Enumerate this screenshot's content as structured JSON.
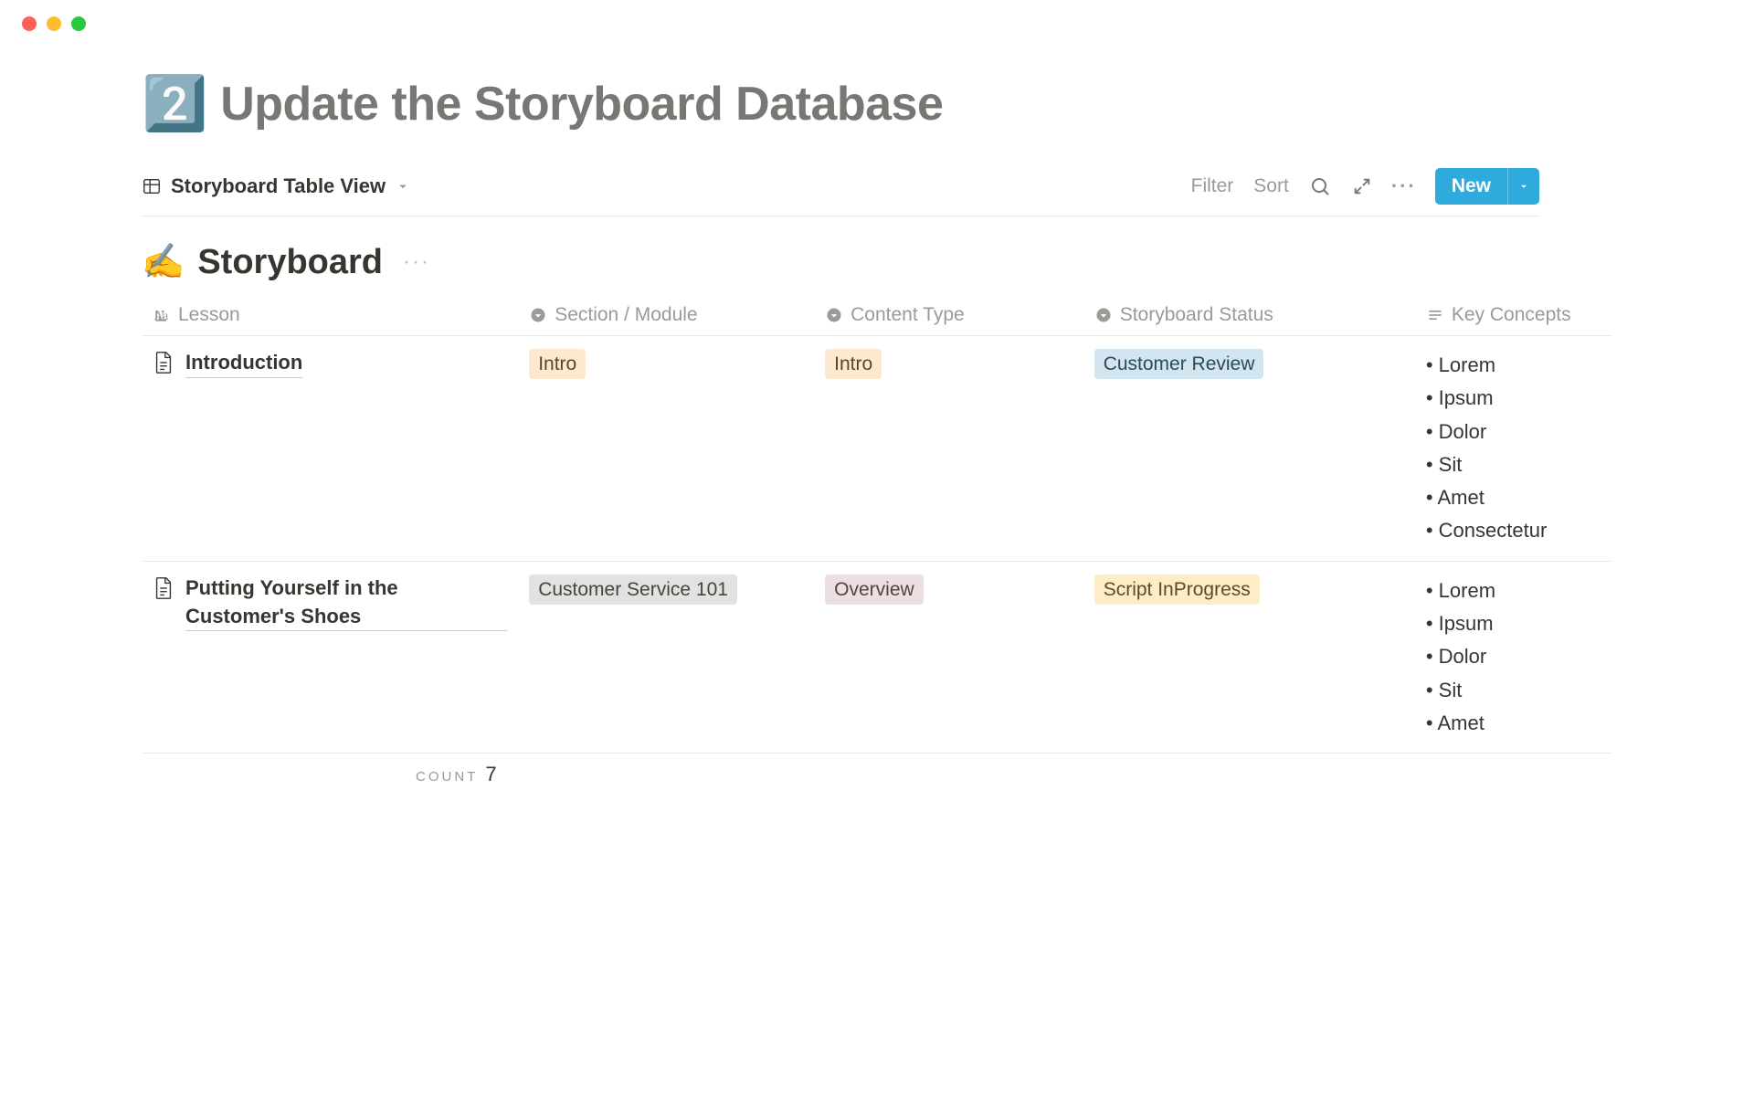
{
  "page": {
    "emoji": "2️⃣",
    "title": "Update the Storyboard Database"
  },
  "view": {
    "name": "Storyboard Table View",
    "filter_label": "Filter",
    "sort_label": "Sort",
    "new_label": "New"
  },
  "database": {
    "emoji": "✍️",
    "name": "Storyboard"
  },
  "columns": {
    "lesson": "Lesson",
    "section": "Section / Module",
    "content_type": "Content Type",
    "status": "Storyboard Status",
    "concepts": "Key Concepts"
  },
  "rows": [
    {
      "lesson": "Introduction",
      "section": {
        "text": "Intro",
        "color": "orange"
      },
      "content_type": {
        "text": "Intro",
        "color": "orange"
      },
      "status": {
        "text": "Customer Review",
        "color": "blue"
      },
      "concepts": [
        "Lorem",
        "Ipsum",
        "Dolor",
        "Sit",
        "Amet",
        "Consectetur"
      ]
    },
    {
      "lesson": "Putting Yourself in the Customer's Shoes",
      "section": {
        "text": "Customer Service 101",
        "color": "gray"
      },
      "content_type": {
        "text": "Overview",
        "color": "pink"
      },
      "status": {
        "text": "Script InProgress",
        "color": "yellow"
      },
      "concepts": [
        "Lorem",
        "Ipsum",
        "Dolor",
        "Sit",
        "Amet"
      ]
    }
  ],
  "footer": {
    "count_label": "COUNT",
    "count_value": "7"
  }
}
